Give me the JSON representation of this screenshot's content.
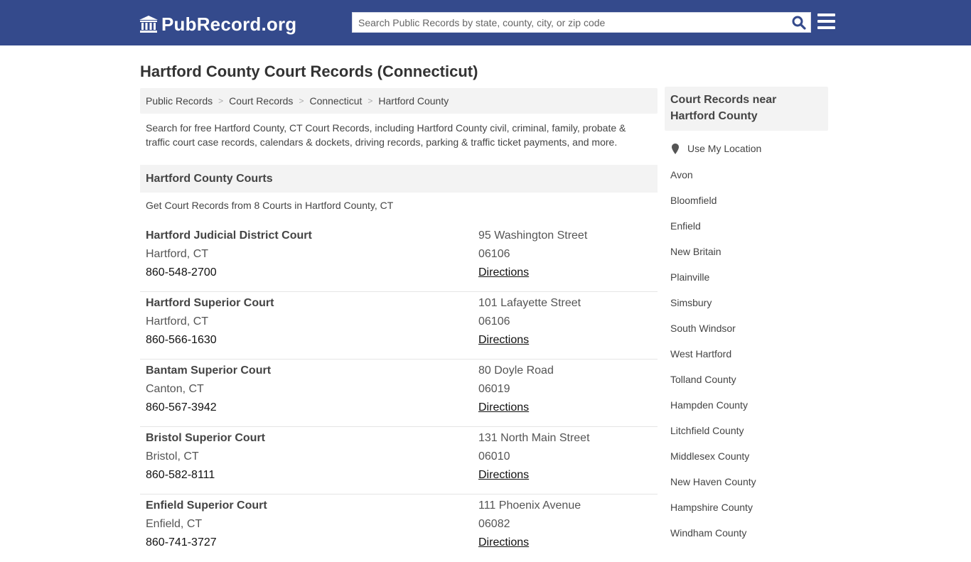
{
  "header": {
    "logo_text": "PubRecord.org",
    "search_placeholder": "Search Public Records by state, county, city, or zip code"
  },
  "page": {
    "title": "Hartford County Court Records (Connecticut)",
    "intro": "Search for free Hartford County, CT Court Records, including Hartford County civil, criminal, family, probate & traffic court case records, calendars & dockets, driving records, parking & traffic ticket payments, and more."
  },
  "breadcrumb": [
    "Public Records",
    "Court Records",
    "Connecticut",
    "Hartford County"
  ],
  "courts_section": {
    "heading": "Hartford County Courts",
    "summary": "Get Court Records from 8 Courts in Hartford County, CT",
    "directions_label": "Directions",
    "courts": [
      {
        "name": "Hartford Judicial District Court",
        "city": "Hartford, CT",
        "phone": "860-548-2700",
        "street": "95 Washington Street",
        "zip": "06106"
      },
      {
        "name": "Hartford Superior Court",
        "city": "Hartford, CT",
        "phone": "860-566-1630",
        "street": "101 Lafayette Street",
        "zip": "06106"
      },
      {
        "name": "Bantam Superior Court",
        "city": "Canton, CT",
        "phone": "860-567-3942",
        "street": "80 Doyle Road",
        "zip": "06019"
      },
      {
        "name": "Bristol Superior Court",
        "city": "Bristol, CT",
        "phone": "860-582-8111",
        "street": "131 North Main Street",
        "zip": "06010"
      },
      {
        "name": "Enfield Superior Court",
        "city": "Enfield, CT",
        "phone": "860-741-3727",
        "street": "111 Phoenix Avenue",
        "zip": "06082"
      }
    ]
  },
  "sidebar": {
    "heading": "Court Records near Hartford County",
    "use_location": "Use My Location",
    "places": [
      "Avon",
      "Bloomfield",
      "Enfield",
      "New Britain",
      "Plainville",
      "Simsbury",
      "South Windsor",
      "West Hartford",
      "Tolland County",
      "Hampden County",
      "Litchfield County",
      "Middlesex County",
      "New Haven County",
      "Hampshire County",
      "Windham County"
    ]
  },
  "colors": {
    "header_bg": "#344a8c",
    "search_icon": "#344a8c",
    "panel_bg": "#f3f3f3"
  }
}
